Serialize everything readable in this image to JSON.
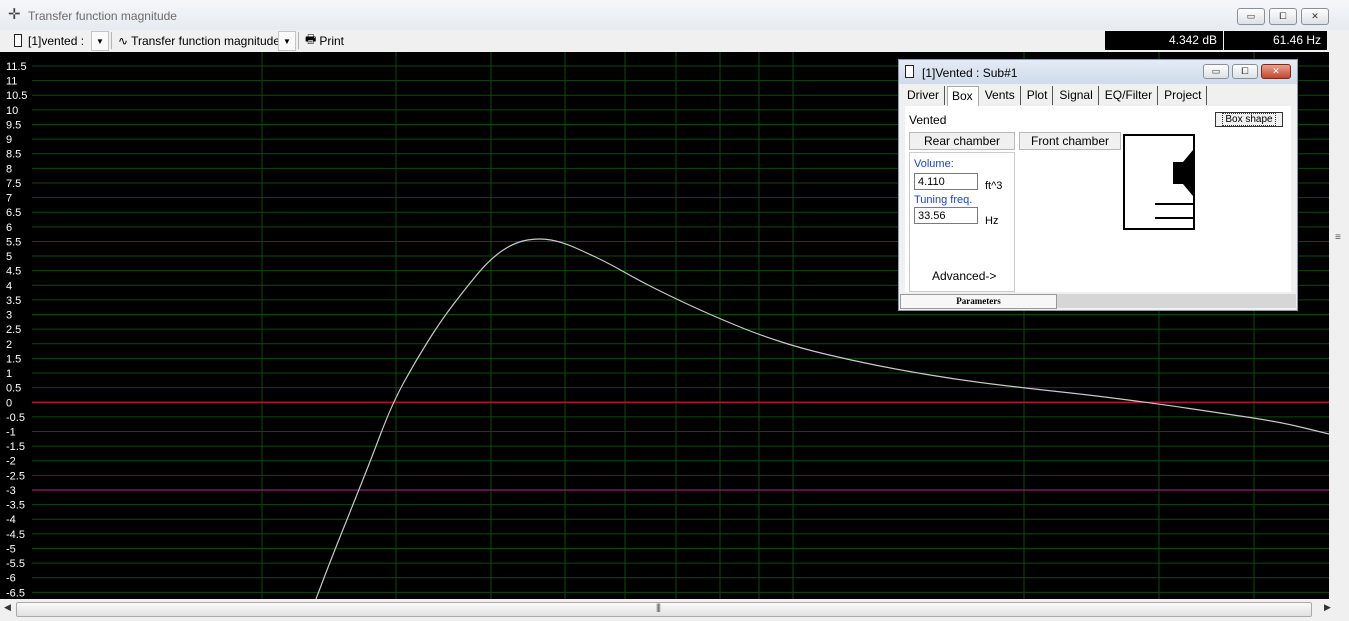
{
  "window": {
    "title": "Transfer function magnitude",
    "app_icon": "move-cross-icon",
    "controls": {
      "minimize": "▭",
      "maximize": "⧠",
      "close": "✕"
    }
  },
  "toolbar": {
    "driver_select": "[1]vented :",
    "plot_select": "Transfer function magnitude",
    "print_label": "Print",
    "readout_db": "4.342 dB",
    "readout_hz": "61.46 Hz"
  },
  "plot": {
    "y_ticks": [
      "11.5",
      "11",
      "10.5",
      "10",
      "9.5",
      "9",
      "8.5",
      "8",
      "7.5",
      "7",
      "6.5",
      "6",
      "5.5",
      "5",
      "4.5",
      "4",
      "3.5",
      "3",
      "2.5",
      "2",
      "1.5",
      "1",
      "0.5",
      "0",
      "-0.5",
      "-1",
      "-1.5",
      "-2",
      "-2.5",
      "-3",
      "-3.5",
      "-4",
      "-4.5",
      "-5",
      "-5.5",
      "-6",
      "-6.5"
    ],
    "reference_lines": [
      {
        "value": 0,
        "color": "#c8102e"
      },
      {
        "value": -3,
        "color": "#9b1a6e"
      }
    ],
    "curve_color": "#c8c8c8",
    "grid_color": "#0d4a0d"
  },
  "dialog": {
    "title": "[1]Vented : Sub#1",
    "tabs": [
      "Driver",
      "Box",
      "Vents",
      "Plot",
      "Signal",
      "EQ/Filter",
      "Project"
    ],
    "active_tab": "Box",
    "box_type": "Vented",
    "box_shape_button": "Box shape",
    "rear_chamber": "Rear chamber",
    "front_chamber": "Front chamber",
    "volume_label": "Volume:",
    "volume_value": "4.110",
    "volume_unit": "ft^3",
    "tuning_label": "Tuning freq.",
    "tuning_value": "33.56",
    "tuning_unit": "Hz",
    "advanced": "Advanced->",
    "status_tab": "Parameters"
  }
}
